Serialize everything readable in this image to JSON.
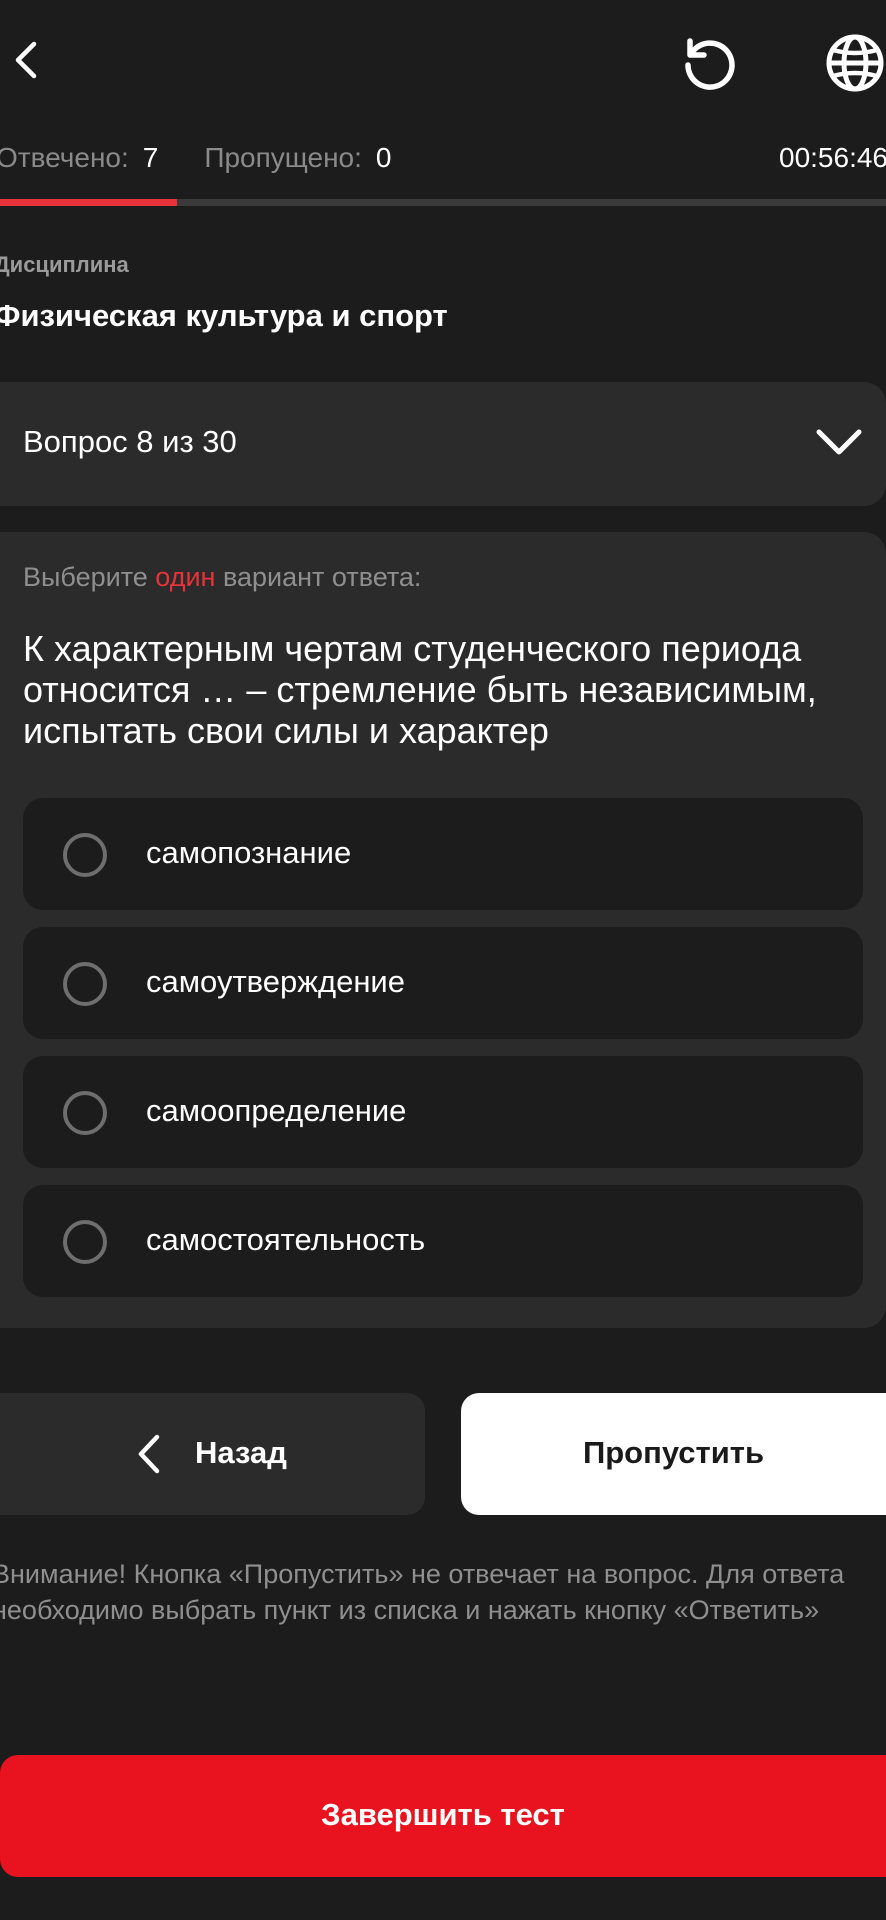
{
  "header": {
    "back_icon": "chevron-left-icon",
    "reset_icon": "reset-icon",
    "language_icon": "globe-icon"
  },
  "stats": {
    "answered_label": "Отвечено:",
    "answered_value": "7",
    "skipped_label": "Пропущено:",
    "skipped_value": "0",
    "timer": "00:56:46"
  },
  "progress": {
    "fraction": 0.2,
    "fill_color": "#e8323a"
  },
  "discipline": {
    "label": "Дисциплина",
    "title": "Физическая культура и спорт"
  },
  "question_selector": {
    "label": "Вопрос 8 из 30"
  },
  "question": {
    "instruction_before": "Выберите ",
    "instruction_accent": "один",
    "instruction_after": " вариант ответа:",
    "text": "К характерным чертам студенческого периода относится … – стремление быть независимым, испытать свои силы и характер",
    "options": [
      {
        "label": "самопознание"
      },
      {
        "label": "самоутверждение"
      },
      {
        "label": "самоопределение"
      },
      {
        "label": "самостоятельность"
      }
    ]
  },
  "nav": {
    "back_label": "Назад",
    "skip_label": "Пропустить"
  },
  "notice": "Внимание! Кнопка «Пропустить» не отвечает на вопрос. Для ответа необходимо выбрать пункт из списка и нажать кнопку «Ответить»",
  "finish": {
    "label": "Завершить тест",
    "color": "#e8131e"
  }
}
